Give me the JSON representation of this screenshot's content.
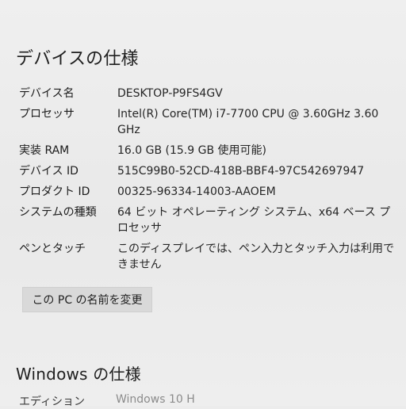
{
  "device_specs": {
    "title": "デバイスの仕様",
    "rows": [
      {
        "label": "デバイス名",
        "value": "DESKTOP-P9FS4GV"
      },
      {
        "label": "プロセッサ",
        "value": "Intel(R) Core(TM) i7-7700 CPU @ 3.60GHz   3.60 GHz"
      },
      {
        "label": "実装 RAM",
        "value": "16.0 GB (15.9 GB 使用可能)"
      },
      {
        "label": "デバイス ID",
        "value": "515C99B0-52CD-418B-BBF4-97C542697947"
      },
      {
        "label": "プロダクト ID",
        "value": "00325-96334-14003-AAOEM"
      },
      {
        "label": "システムの種類",
        "value": "64 ビット オペレーティング システム、x64 ベース プロセッサ"
      },
      {
        "label": "ペンとタッチ",
        "value": "このディスプレイでは、ペン入力とタッチ入力は利用できません"
      }
    ],
    "rename_button": "この PC の名前を変更"
  },
  "windows_specs": {
    "title": "Windows の仕様",
    "edition_label": "エディション",
    "edition_value": "Windows 10 H"
  }
}
